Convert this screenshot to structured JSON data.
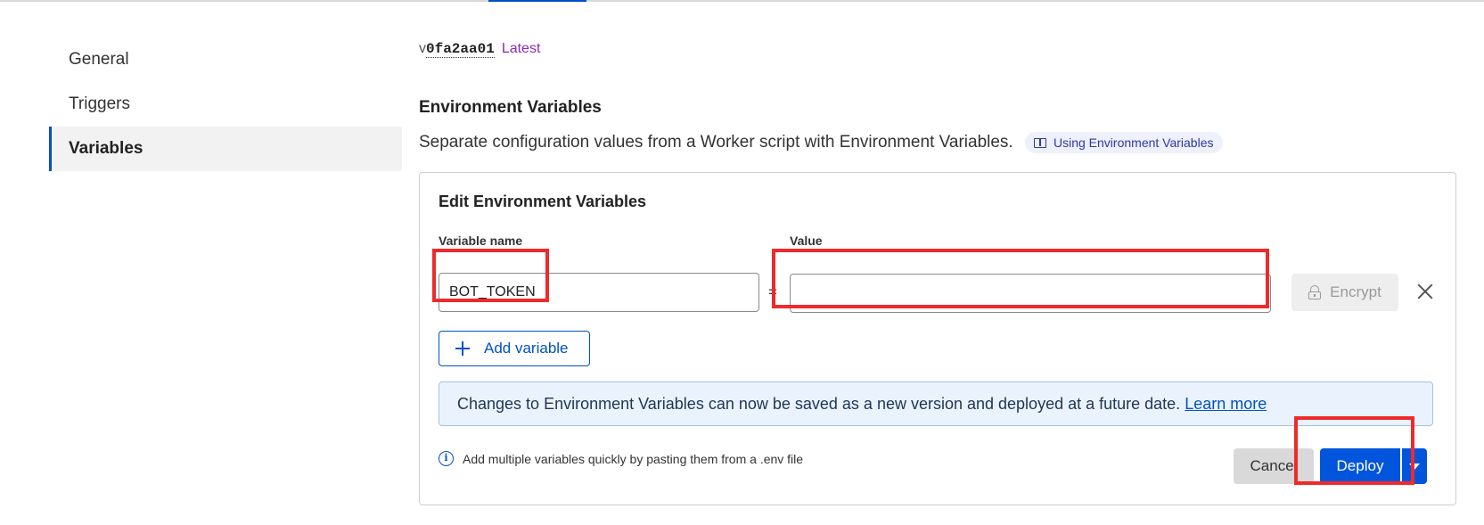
{
  "sidebar": {
    "items": [
      {
        "label": "General",
        "active": false
      },
      {
        "label": "Triggers",
        "active": false
      },
      {
        "label": "Variables",
        "active": true
      }
    ]
  },
  "version": {
    "prefix": "v",
    "id": "0fa2aa01",
    "tag": "Latest"
  },
  "env": {
    "title": "Environment Variables",
    "description": "Separate configuration values from a Worker script with Environment Variables.",
    "doc_link": "Using Environment Variables",
    "doc_icon": "book-icon"
  },
  "editor": {
    "title": "Edit Environment Variables",
    "name_label": "Variable name",
    "value_label": "Value",
    "rows": [
      {
        "name": "BOT_TOKEN",
        "value": ""
      }
    ],
    "equals": "=",
    "encrypt_label": "Encrypt",
    "add_label": "Add variable",
    "banner_text": "Changes to Environment Variables can now be saved as a new version and deployed at a future date.",
    "banner_link": "Learn more",
    "hint": "Add multiple variables quickly by pasting them from a .env file",
    "cancel_label": "Cancel",
    "deploy_label": "Deploy"
  },
  "colors": {
    "accent": "#0051c3",
    "deploy": "#0055dc",
    "latest": "#8b2ab8",
    "highlight": "#ee2a2a",
    "banner_bg": "#eaf3fd"
  }
}
